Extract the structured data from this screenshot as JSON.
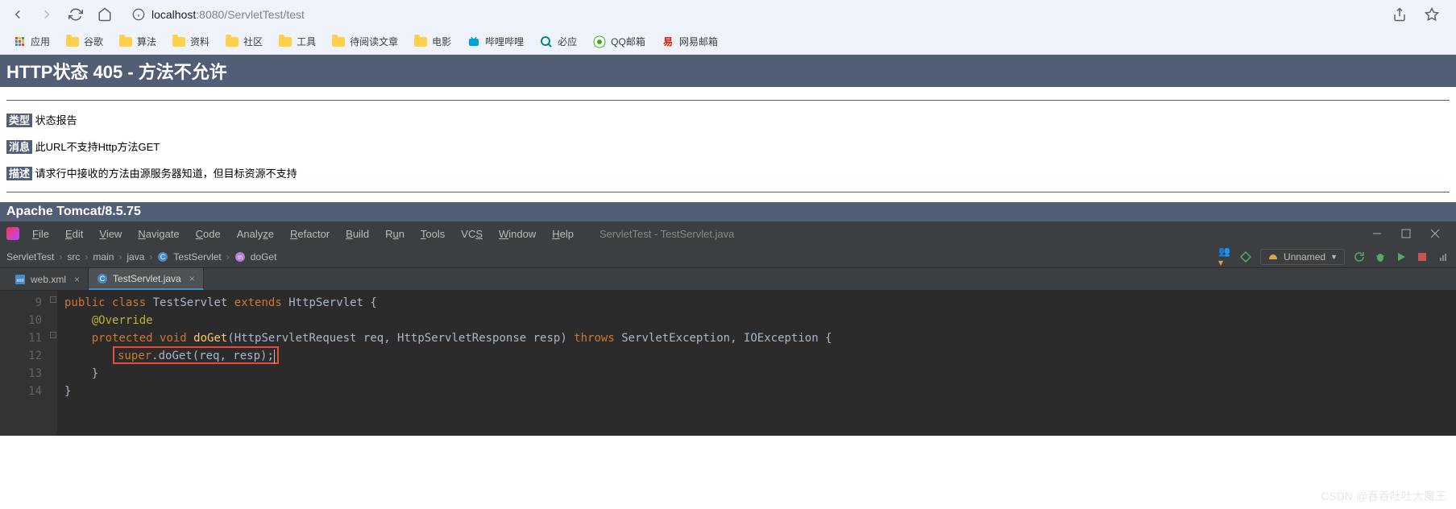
{
  "browser": {
    "url_host": "localhost",
    "url_port": ":8080",
    "url_path": "/ServletTest/test"
  },
  "bookmarks": {
    "apps": "应用",
    "items": [
      {
        "label": "谷歌",
        "icon": "folder"
      },
      {
        "label": "算法",
        "icon": "folder"
      },
      {
        "label": "资料",
        "icon": "folder"
      },
      {
        "label": "社区",
        "icon": "folder"
      },
      {
        "label": "工具",
        "icon": "folder"
      },
      {
        "label": "待阅读文章",
        "icon": "folder"
      },
      {
        "label": "电影",
        "icon": "folder"
      },
      {
        "label": "哔哩哔哩",
        "icon": "bili"
      },
      {
        "label": "必应",
        "icon": "bing"
      },
      {
        "label": "QQ邮箱",
        "icon": "qqmail"
      },
      {
        "label": "网易邮箱",
        "icon": "163"
      }
    ]
  },
  "tomcat": {
    "h1": "HTTP状态 405 - 方法不允许",
    "type_label": "类型",
    "type_value": "状态报告",
    "message_label": "消息",
    "message_value": "此URL不支持Http方法GET",
    "desc_label": "描述",
    "desc_value": "请求行中接收的方法由源服务器知道，但目标资源不支持",
    "footer": "Apache Tomcat/8.5.75"
  },
  "ide": {
    "menu": [
      "File",
      "Edit",
      "View",
      "Navigate",
      "Code",
      "Analyze",
      "Refactor",
      "Build",
      "Run",
      "Tools",
      "VCS",
      "Window",
      "Help"
    ],
    "title": "ServletTest - TestServlet.java",
    "breadcrumb": [
      "ServletTest",
      "src",
      "main",
      "java",
      "TestServlet",
      "doGet"
    ],
    "run_config": "Unnamed",
    "tabs": [
      {
        "label": "web.xml",
        "active": false
      },
      {
        "label": "TestServlet.java",
        "active": true
      }
    ],
    "gutter": [
      "9",
      "10",
      "11",
      "12",
      "13",
      "14"
    ],
    "code": {
      "l9_public": "public",
      "l9_class": "class",
      "l9_name": "TestServlet",
      "l9_extends": "extends",
      "l9_parent": "HttpServlet {",
      "l10_ann": "@Override",
      "l11_protected": "protected",
      "l11_void": "void",
      "l11_method": "doGet",
      "l11_params": "(HttpServletRequest req, HttpServletResponse resp)",
      "l11_throws": "throws",
      "l11_excs": "ServletException, IOException {",
      "l12_super": "super",
      "l12_call": ".doGet(req, resp);",
      "l13": "    }",
      "l14": "}"
    }
  },
  "watermark": "CSDN @吞吞吐吐大魔王"
}
